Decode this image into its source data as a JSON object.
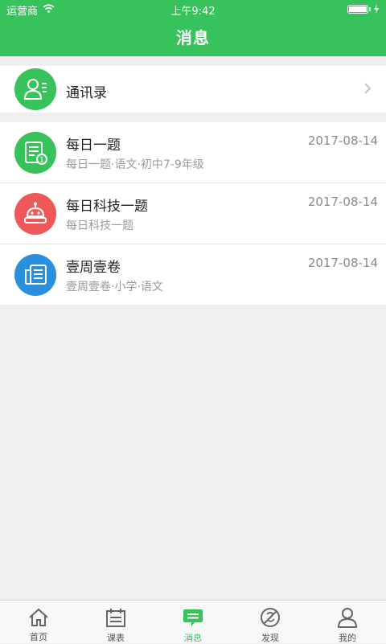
{
  "status_bar": {
    "carrier": "运营商",
    "time": "上午9:42"
  },
  "nav": {
    "title": "消息"
  },
  "contacts": {
    "label": "通讯录"
  },
  "messages": [
    {
      "title": "每日一题",
      "date": "2017-08-14",
      "subtitle": "每日一题·语文·初中7-9年级",
      "color": "#37c25b"
    },
    {
      "title": "每日科技一题",
      "date": "2017-08-14",
      "subtitle": "每日科技一题",
      "color": "#ef5858"
    },
    {
      "title": "壹周壹卷",
      "date": "2017-08-14",
      "subtitle": "壹周壹卷·小学·语文",
      "color": "#2a8fdc"
    }
  ],
  "tabs": [
    {
      "label": "首页",
      "icon": "home-icon"
    },
    {
      "label": "课表",
      "icon": "calendar-icon"
    },
    {
      "label": "消息",
      "icon": "message-icon",
      "active": true
    },
    {
      "label": "发现",
      "icon": "discover-icon"
    },
    {
      "label": "我的",
      "icon": "profile-icon"
    }
  ],
  "colors": {
    "brand": "#37c25b",
    "background": "#efefef"
  }
}
